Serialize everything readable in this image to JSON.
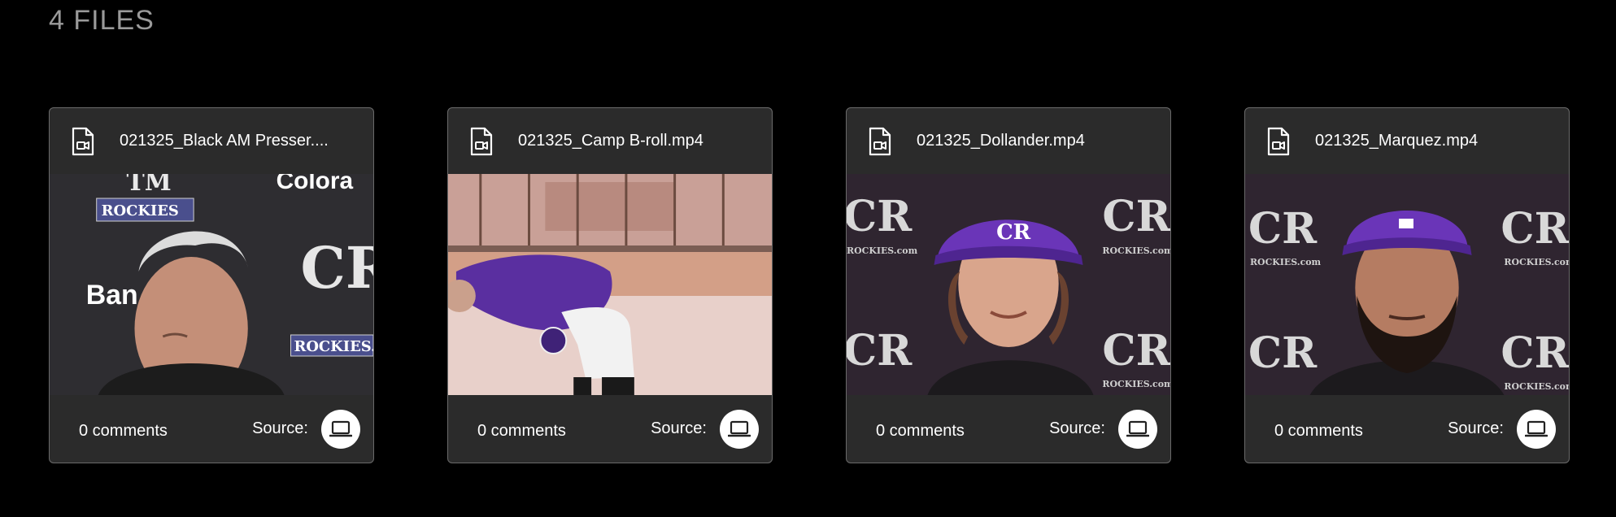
{
  "page": {
    "heading": "4 FILES"
  },
  "files": [
    {
      "name": "021325_Black AM Presser....",
      "comments": "0 comments",
      "source_label": "Source:",
      "source_icon": "laptop-icon",
      "file_icon": "video-file-icon",
      "backdrop_text": [
        "ROCKIES",
        "Colora",
        "Ban Co",
        "ROCKIES.co",
        "TM"
      ]
    },
    {
      "name": "021325_Camp B-roll.mp4",
      "comments": "0 comments",
      "source_label": "Source:",
      "source_icon": "laptop-icon",
      "file_icon": "video-file-icon"
    },
    {
      "name": "021325_Dollander.mp4",
      "comments": "0 comments",
      "source_label": "Source:",
      "source_icon": "laptop-icon",
      "file_icon": "video-file-icon",
      "backdrop_text": [
        "ROCKIES.com"
      ]
    },
    {
      "name": "021325_Marquez.mp4",
      "comments": "0 comments",
      "source_label": "Source:",
      "source_icon": "laptop-icon",
      "file_icon": "video-file-icon",
      "backdrop_text": [
        "ROCKIES.com"
      ]
    }
  ],
  "colors": {
    "background": "#000000",
    "card": "#2b2b2b",
    "card_border": "#6a6a6a",
    "heading": "#9a9a9a",
    "rockies_purple": "#5b2d9e"
  }
}
